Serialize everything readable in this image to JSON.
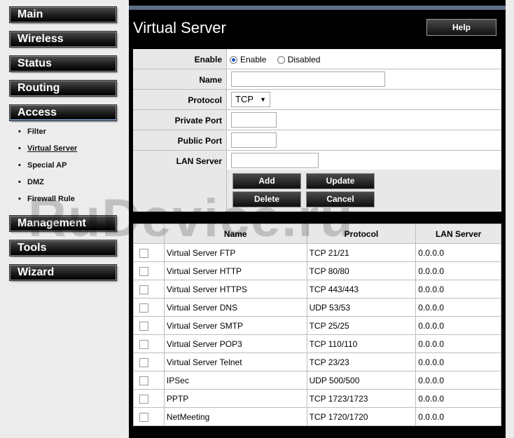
{
  "sidebar": {
    "main_label": "Main",
    "wireless_label": "Wireless",
    "status_label": "Status",
    "routing_label": "Routing",
    "access_label": "Access",
    "access_items": [
      "Filter",
      "Virtual Server",
      "Special AP",
      "DMZ",
      "Firewall Rule"
    ],
    "management_label": "Management",
    "tools_label": "Tools",
    "wizard_label": "Wizard"
  },
  "header": {
    "title": "Virtual Server",
    "help_label": "Help"
  },
  "form": {
    "enable_label": "Enable",
    "enable_option": "Enable",
    "disabled_option": "Disabled",
    "enable_selected": "Enable",
    "name_label": "Name",
    "name_value": "",
    "protocol_label": "Protocol",
    "protocol_value": "TCP",
    "private_port_label": "Private Port",
    "private_port_value": "",
    "public_port_label": "Public Port",
    "public_port_value": "",
    "lan_server_label": "LAN Server",
    "lan_server_value": "",
    "add_label": "Add",
    "update_label": "Update",
    "delete_label": "Delete",
    "cancel_label": "Cancel"
  },
  "table": {
    "headers": [
      "",
      "Name",
      "Protocol",
      "LAN Server"
    ],
    "rows": [
      [
        "Virtual Server FTP",
        "TCP 21/21",
        "0.0.0.0"
      ],
      [
        "Virtual Server HTTP",
        "TCP 80/80",
        "0.0.0.0"
      ],
      [
        "Virtual Server HTTPS",
        "TCP 443/443",
        "0.0.0.0"
      ],
      [
        "Virtual Server DNS",
        "UDP 53/53",
        "0.0.0.0"
      ],
      [
        "Virtual Server SMTP",
        "TCP 25/25",
        "0.0.0.0"
      ],
      [
        "Virtual Server POP3",
        "TCP 110/110",
        "0.0.0.0"
      ],
      [
        "Virtual Server Telnet",
        "TCP 23/23",
        "0.0.0.0"
      ],
      [
        "IPSec",
        "UDP 500/500",
        "0.0.0.0"
      ],
      [
        "PPTP",
        "TCP 1723/1723",
        "0.0.0.0"
      ],
      [
        "NetMeeting",
        "TCP 1720/1720",
        "0.0.0.0"
      ]
    ]
  },
  "watermark": "RuDevice.ru"
}
